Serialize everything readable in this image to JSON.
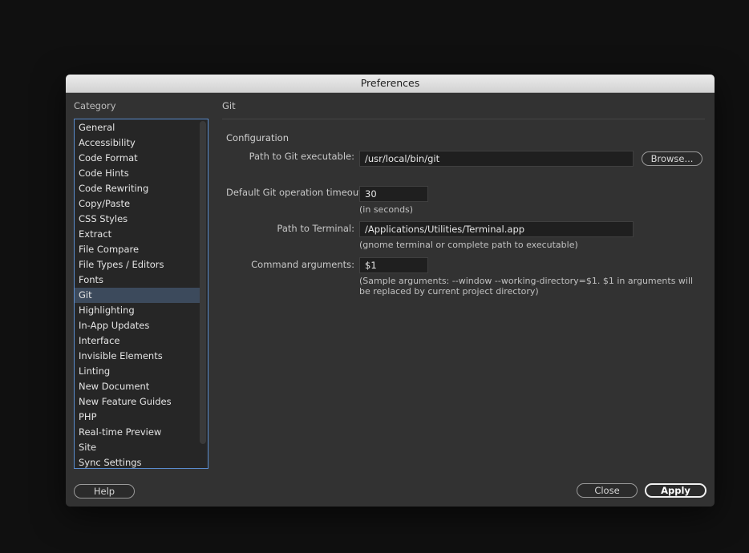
{
  "window": {
    "title": "Preferences"
  },
  "sidebar": {
    "heading": "Category",
    "items": [
      {
        "label": "General"
      },
      {
        "label": "Accessibility"
      },
      {
        "label": "Code Format"
      },
      {
        "label": "Code Hints"
      },
      {
        "label": "Code Rewriting"
      },
      {
        "label": "Copy/Paste"
      },
      {
        "label": "CSS Styles"
      },
      {
        "label": "Extract"
      },
      {
        "label": "File Compare"
      },
      {
        "label": "File Types / Editors"
      },
      {
        "label": "Fonts"
      },
      {
        "label": "Git",
        "selected": true
      },
      {
        "label": "Highlighting"
      },
      {
        "label": "In-App Updates"
      },
      {
        "label": "Interface"
      },
      {
        "label": "Invisible Elements"
      },
      {
        "label": "Linting"
      },
      {
        "label": "New Document"
      },
      {
        "label": "New Feature Guides"
      },
      {
        "label": "PHP"
      },
      {
        "label": "Real-time Preview"
      },
      {
        "label": "Site"
      },
      {
        "label": "Sync Settings"
      }
    ]
  },
  "panel": {
    "title": "Git",
    "section": "Configuration",
    "git_path": {
      "label": "Path to Git executable:",
      "value": "/usr/local/bin/git",
      "browse_label": "Browse..."
    },
    "timeout": {
      "label": "Default Git operation timeout:",
      "value": "30",
      "hint": "(in seconds)"
    },
    "terminal": {
      "label": "Path to Terminal:",
      "value": "/Applications/Utilities/Terminal.app",
      "hint": "(gnome terminal or complete path to executable)"
    },
    "command_args": {
      "label": "Command arguments:",
      "value": "$1",
      "hint_line1": "(Sample arguments: --window --working-directory=$1. $1 in arguments will",
      "hint_line2": "be replaced by current project directory)"
    }
  },
  "footer": {
    "help_label": "Help",
    "close_label": "Close",
    "apply_label": "Apply"
  },
  "colors": {
    "dialog_background": "#323232",
    "selection": "#3c4a5c",
    "list_border": "#5a8ccd"
  }
}
